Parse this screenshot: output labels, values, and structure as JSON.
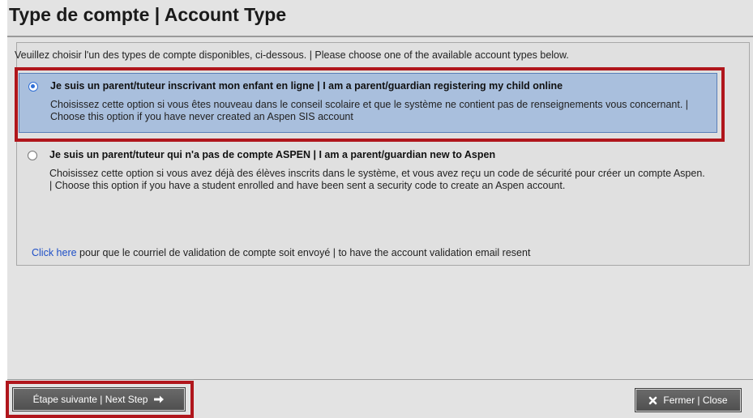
{
  "dialog": {
    "title": "Type de compte | Account Type",
    "instructions": "Veuillez choisir l'un des types de compte disponibles, ci-dessous. | Please choose one of the available account types below."
  },
  "options": [
    {
      "title": "Je suis un parent/tuteur inscrivant mon enfant en ligne | I am a parent/guardian registering my child online",
      "description": "Choisissez cette option si vous êtes nouveau dans le conseil scolaire et que le système ne contient pas de renseignements vous concernant. | Choose this option if you have never created an Aspen SIS account",
      "selected": true
    },
    {
      "title": "Je suis un parent/tuteur qui n'a pas de compte ASPEN | I am a parent/guardian new to Aspen",
      "description": "Choisissez cette option si vous avez déjà des élèves inscrits dans le système, et vous avez reçu un code de sécurité pour créer un compte Aspen. | Choose this option if you have a student enrolled and have been sent a security code to create an Aspen account.",
      "selected": false
    }
  ],
  "resend": {
    "link_text": "Click here",
    "rest_text": " pour que le courriel de validation de compte soit envoyé | to have the account validation email resent"
  },
  "footer": {
    "next_label": "Étape suivante | Next Step",
    "next_icon": "arrow-right-icon",
    "close_label": "Fermer | Close",
    "close_icon": "x-icon"
  },
  "colors": {
    "selected_option_bg": "#a9bfdd",
    "highlight_border": "#b0161c",
    "link": "#1e4fc7"
  }
}
